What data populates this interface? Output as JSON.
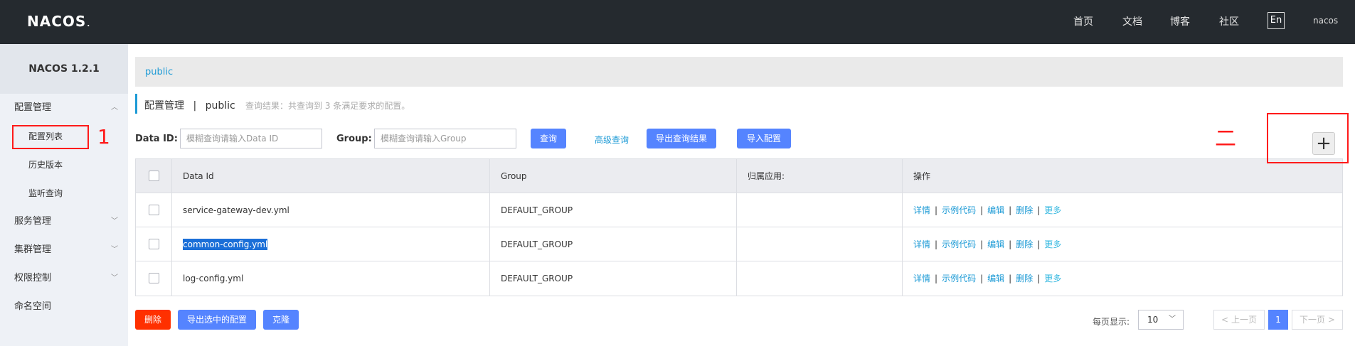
{
  "header": {
    "logo": "NACOS",
    "logo_mark": ".",
    "nav": [
      "首页",
      "文档",
      "博客",
      "社区"
    ],
    "lang": "En",
    "user": "nacos"
  },
  "sidebar": {
    "version": "NACOS 1.2.1",
    "items": [
      {
        "label": "配置管理",
        "expanded": true
      },
      {
        "label": "配置列表",
        "sub": true
      },
      {
        "label": "历史版本",
        "sub": true
      },
      {
        "label": "监听查询",
        "sub": true
      },
      {
        "label": "服务管理"
      },
      {
        "label": "集群管理"
      },
      {
        "label": "权限控制"
      },
      {
        "label": "命名空间"
      }
    ]
  },
  "breadcrumb": "public",
  "page": {
    "title": "配置管理",
    "title_sep": "|",
    "namespace": "public",
    "hint": "查询结果：共查询到 3 条满足要求的配置。"
  },
  "search": {
    "dataid_label": "Data ID:",
    "dataid_placeholder": "模糊查询请输入Data ID",
    "group_label": "Group:",
    "group_placeholder": "模糊查询请输入Group",
    "query_button": "查询",
    "advanced_link": "高级查询",
    "export_results_button": "导出查询结果",
    "import_button": "导入配置"
  },
  "table": {
    "columns": [
      "Data Id",
      "Group",
      "归属应用:",
      "操作"
    ],
    "rows": [
      {
        "data_id": "service-gateway-dev.yml",
        "group": "DEFAULT_GROUP",
        "app": ""
      },
      {
        "data_id": "common-config.yml",
        "group": "DEFAULT_GROUP",
        "app": "",
        "highlighted": true
      },
      {
        "data_id": "log-config.yml",
        "group": "DEFAULT_GROUP",
        "app": ""
      }
    ],
    "ops": [
      "详情",
      "示例代码",
      "编辑",
      "删除",
      "更多"
    ]
  },
  "bulk": {
    "delete": "删除",
    "export_selected": "导出选中的配置",
    "clone": "克隆"
  },
  "pager": {
    "label": "每页显示:",
    "page_size": "10",
    "prev": "上一页",
    "current": "1",
    "next": "下一页"
  },
  "annotations": {
    "mark1": "1",
    "mark2": "二"
  },
  "colors": {
    "topbar": "#252a2f",
    "primary": "#5584ff",
    "danger": "#ff3000",
    "link": "#1e9bd6",
    "annotation": "#ff1a1a"
  }
}
